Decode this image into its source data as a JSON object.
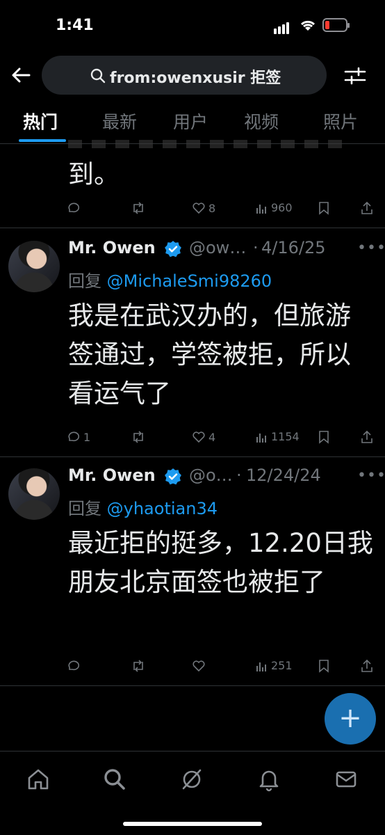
{
  "status_bar": {
    "time": "1:41",
    "battery_level": 0.2
  },
  "search": {
    "query": "from:owenxusir 拒签"
  },
  "tabs": [
    {
      "label": "热门",
      "active": true
    },
    {
      "label": "最新",
      "active": false
    },
    {
      "label": "用户",
      "active": false
    },
    {
      "label": "视频",
      "active": false
    },
    {
      "label": "照片",
      "active": false
    }
  ],
  "tweet0": {
    "body_tail": "到。",
    "replies": "",
    "likes": "8",
    "views": "960"
  },
  "tweet1": {
    "name": "Mr. Owen",
    "handle": "@ow…",
    "dot": "·",
    "date": "4/16/25",
    "reply_prefix": "回复",
    "reply_to": "@MichaleSmi98260",
    "body": "我是在武汉办的，但旅游签通过，学签被拒，所以看运气了",
    "replies": "1",
    "likes": "4",
    "views": "1154"
  },
  "tweet2": {
    "name": "Mr. Owen",
    "handle": "@o…",
    "dot": "·",
    "date": "12/24/24",
    "reply_prefix": "回复",
    "reply_to": "@yhaotian34",
    "body": "最近拒的挺多，12.20日我朋友北京面签也被拒了",
    "replies": "",
    "likes": "",
    "views": "251"
  },
  "fab": {
    "label": "+"
  },
  "colors": {
    "accent": "#1d9bf0",
    "background": "#000000",
    "muted": "#71767b"
  }
}
